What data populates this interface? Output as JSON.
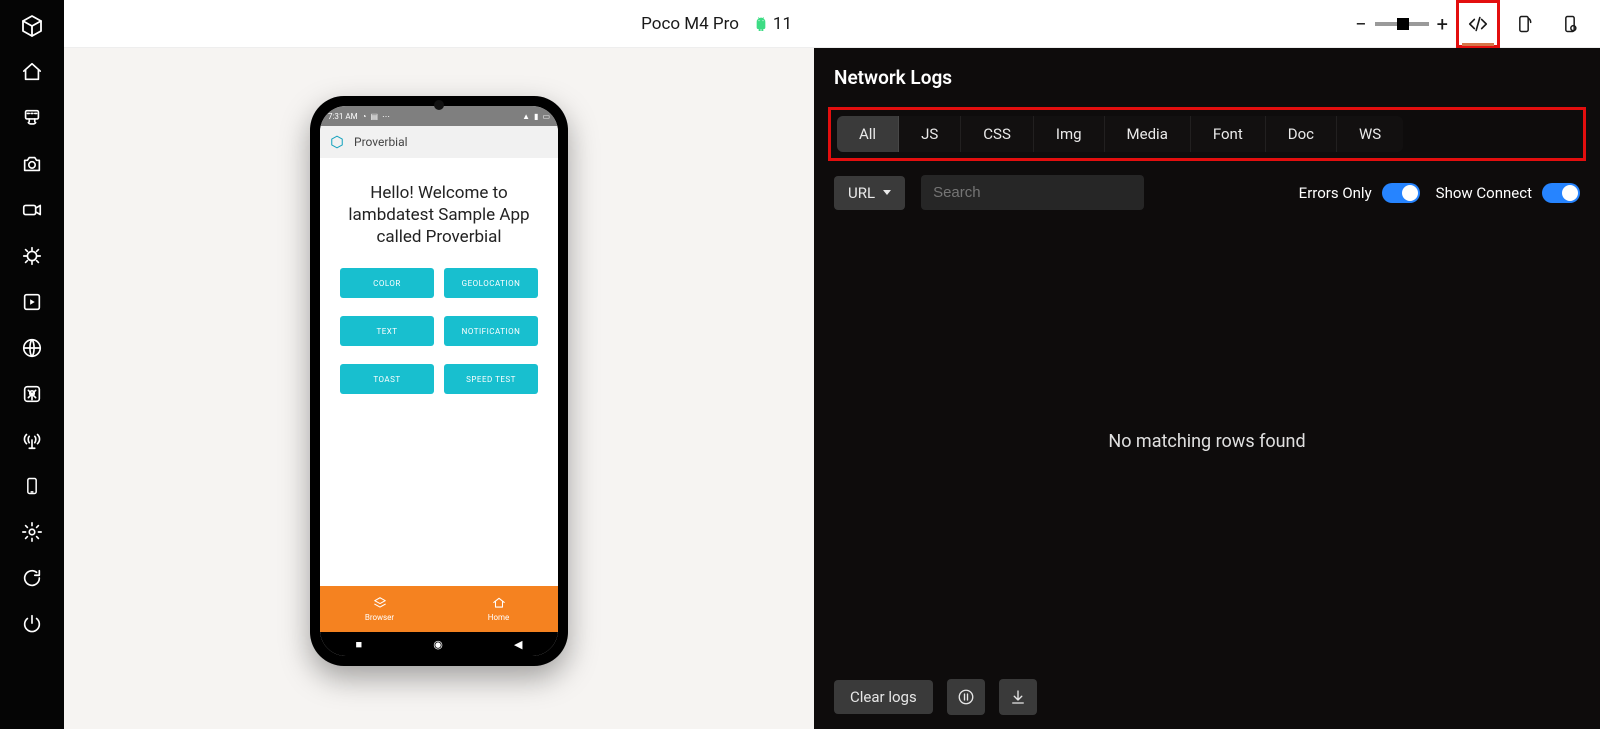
{
  "topbar": {
    "device_name": "Poco M4 Pro",
    "os_version": "11"
  },
  "phone": {
    "status": {
      "time": "7:31 AM"
    },
    "app_title": "Proverbial",
    "welcome_line1": "Hello! Welcome to",
    "welcome_line2": "lambdatest Sample App",
    "welcome_line3": "called Proverbial",
    "buttons": [
      "COLOR",
      "GEOLOCATION",
      "TEXT",
      "NOTIFICATION",
      "TOAST",
      "SPEED TEST"
    ],
    "bottom_nav": [
      "Browser",
      "Home"
    ]
  },
  "net": {
    "title": "Network Logs",
    "filters": [
      "All",
      "JS",
      "CSS",
      "Img",
      "Media",
      "Font",
      "Doc",
      "WS"
    ],
    "active_filter": "All",
    "url_label": "URL",
    "search_placeholder": "Search",
    "errors_only_label": "Errors Only",
    "show_connect_label": "Show Connect",
    "empty_message": "No matching rows found",
    "clear_logs_label": "Clear logs"
  }
}
